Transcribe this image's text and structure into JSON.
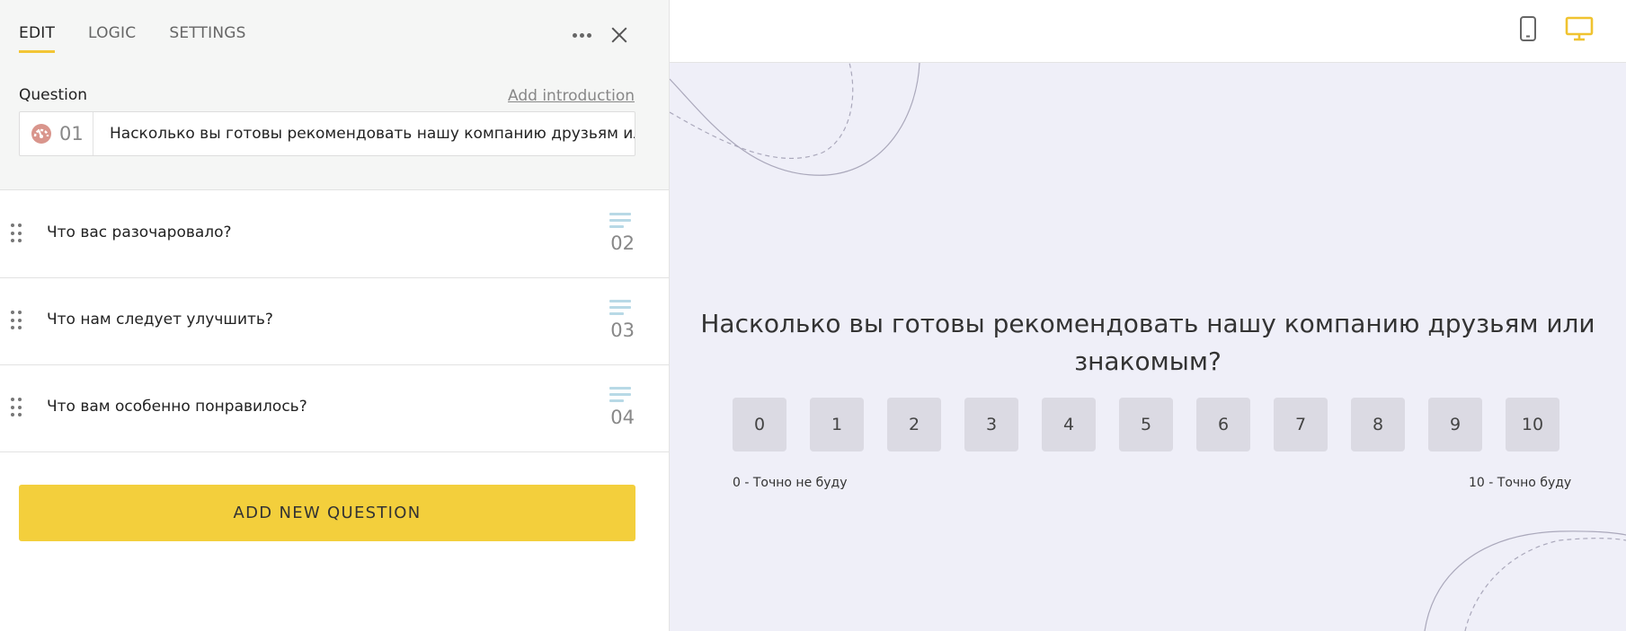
{
  "editor": {
    "tabs": [
      {
        "label": "EDIT",
        "active": true
      },
      {
        "label": "LOGIC",
        "active": false
      },
      {
        "label": "SETTINGS",
        "active": false
      }
    ],
    "question_label": "Question",
    "add_introduction": "Add introduction",
    "current_question": {
      "number": "01",
      "text": "Насколько вы готовы рекомендовать нашу компанию друзьям ил",
      "icon": "nps-gauge-icon"
    },
    "questions": [
      {
        "text": "Что вас разочаровало?",
        "number": "02",
        "icon": "text-answer-icon"
      },
      {
        "text": "Что нам следует улучшить?",
        "number": "03",
        "icon": "text-answer-icon"
      },
      {
        "text": "Что вам особенно понравилось?",
        "number": "04",
        "icon": "text-answer-icon"
      }
    ],
    "add_button_label": "ADD NEW QUESTION"
  },
  "preview": {
    "question_text": "Насколько вы готовы рекомендовать нашу компанию друзьям или знакомым?",
    "scale": [
      "0",
      "1",
      "2",
      "3",
      "4",
      "5",
      "6",
      "7",
      "8",
      "9",
      "10"
    ],
    "low_label": "0 - Точно не буду",
    "high_label": "10 - Точно буду",
    "active_device": "desktop"
  },
  "colors": {
    "accent": "#f3cf3c",
    "preview_bg": "#efeff8",
    "scale_button": "#dbdae3",
    "nps_icon": "#d9958c",
    "type_icon": "#b8d9e6"
  }
}
